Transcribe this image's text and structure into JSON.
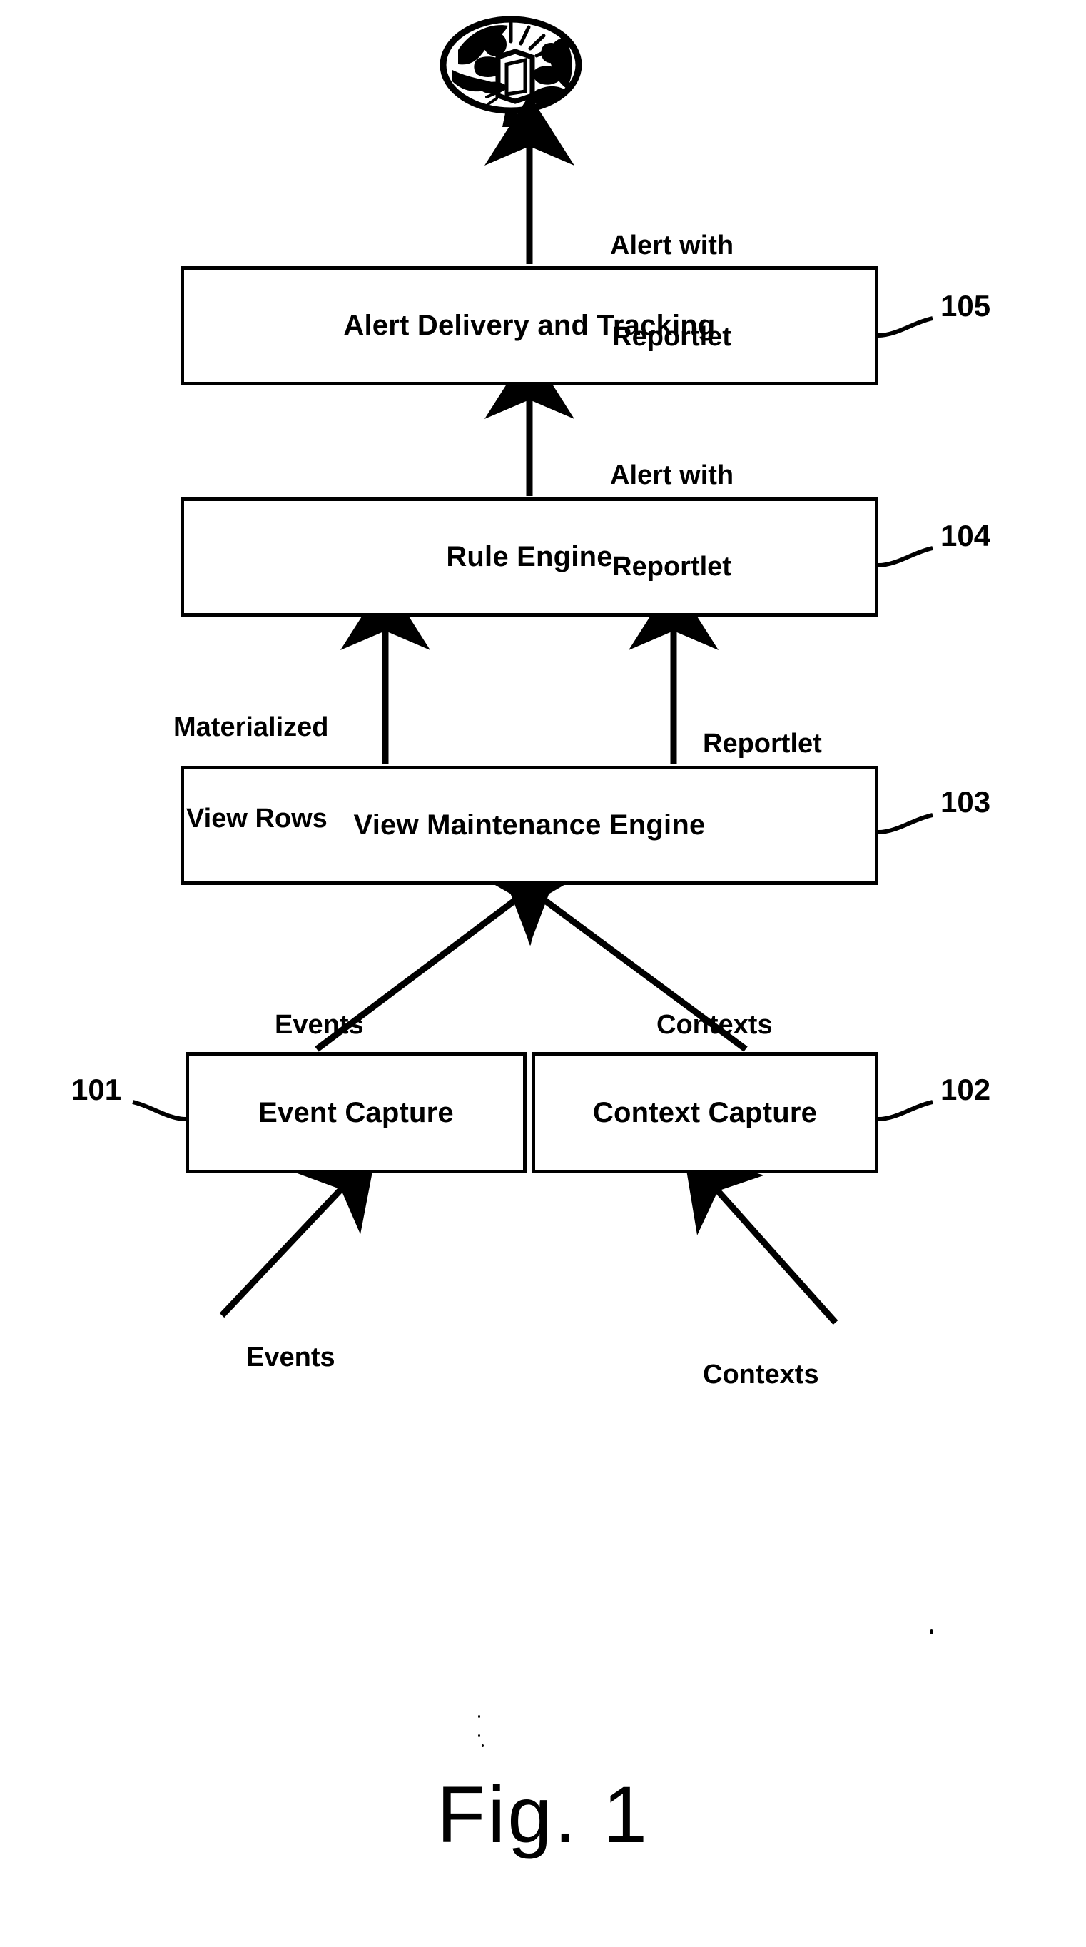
{
  "figure": {
    "caption": "Fig. 1",
    "icon_name": "alert-recipients-icon"
  },
  "boxes": [
    {
      "id": "alert_delivery",
      "label": "Alert Delivery and Tracking",
      "ref": "105"
    },
    {
      "id": "rule_engine",
      "label": "Rule Engine",
      "ref": "104"
    },
    {
      "id": "view_engine",
      "label": "View Maintenance Engine",
      "ref": "103"
    },
    {
      "id": "event_capture",
      "label": "Event Capture",
      "ref": "101"
    },
    {
      "id": "context_capture",
      "label": "Context Capture",
      "ref": "102"
    }
  ],
  "flows": [
    {
      "id": "alert_to_user",
      "line1": "Alert with",
      "line2": "Reportlet"
    },
    {
      "id": "alert_to_delivery",
      "line1": "Alert with",
      "line2": "Reportlet"
    },
    {
      "id": "materialized_rows",
      "line1": "Materialized",
      "line2": "View Rows"
    },
    {
      "id": "reportlet",
      "line1": "Reportlet",
      "line2": ""
    },
    {
      "id": "events_to_view",
      "line1": "Events",
      "line2": ""
    },
    {
      "id": "contexts_to_view",
      "line1": "Contexts",
      "line2": ""
    },
    {
      "id": "events_input",
      "line1": "Events",
      "line2": ""
    },
    {
      "id": "contexts_input",
      "line1": "Contexts",
      "line2": ""
    }
  ],
  "refs": {
    "r105": "105",
    "r104": "104",
    "r103": "103",
    "r102": "102",
    "r101": "101"
  },
  "labels": {
    "alert_delivery_and_tracking": "Alert Delivery and Tracking",
    "rule_engine": "Rule Engine",
    "view_maintenance_engine": "View Maintenance Engine",
    "event_capture": "Event Capture",
    "context_capture": "Context Capture",
    "alert_with": "Alert with",
    "reportlet_word": "Reportlet",
    "materialized": "Materialized",
    "view_rows": "View Rows",
    "events": "Events",
    "contexts": "Contexts"
  },
  "colors": {
    "ink": "#000000",
    "paper": "#ffffff"
  }
}
